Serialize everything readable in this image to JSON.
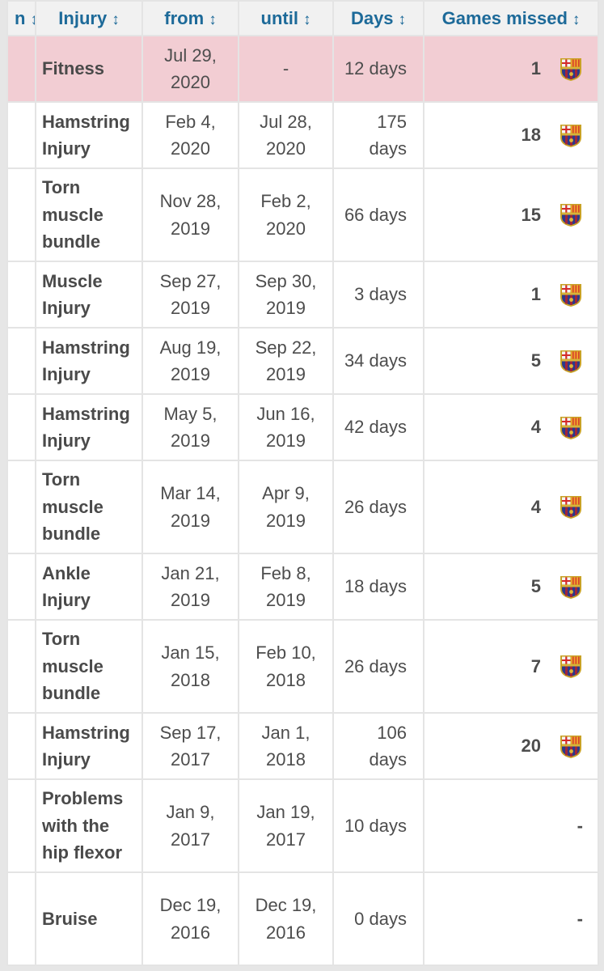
{
  "table": {
    "headers": [
      {
        "label": "n",
        "sort_icon": "↕"
      },
      {
        "label": "Injury",
        "sort_icon": "↕"
      },
      {
        "label": "from",
        "sort_icon": "↕"
      },
      {
        "label": "until",
        "sort_icon": "↕"
      },
      {
        "label": "Days",
        "sort_icon": "↕"
      },
      {
        "label": "Games missed",
        "sort_icon": "↕"
      }
    ],
    "rows": [
      {
        "injury": "Fitness",
        "from": "Jul 29, 2020",
        "until": "-",
        "days": "12 days",
        "games_missed": "1",
        "club_icon": "fc-barcelona-crest-icon",
        "highlighted": true
      },
      {
        "injury": "Hamstring Injury",
        "from": "Feb 4, 2020",
        "until": "Jul 28, 2020",
        "days": "175 days",
        "games_missed": "18",
        "club_icon": "fc-barcelona-crest-icon"
      },
      {
        "injury": "Torn muscle bundle",
        "from": "Nov 28, 2019",
        "until": "Feb 2, 2020",
        "days": "66 days",
        "games_missed": "15",
        "club_icon": "fc-barcelona-crest-icon"
      },
      {
        "injury": "Muscle Injury",
        "from": "Sep 27, 2019",
        "until": "Sep 30, 2019",
        "days": "3 days",
        "games_missed": "1",
        "club_icon": "fc-barcelona-crest-icon"
      },
      {
        "injury": "Hamstring Injury",
        "from": "Aug 19, 2019",
        "until": "Sep 22, 2019",
        "days": "34 days",
        "games_missed": "5",
        "club_icon": "fc-barcelona-crest-icon"
      },
      {
        "injury": "Hamstring Injury",
        "from": "May 5, 2019",
        "until": "Jun 16, 2019",
        "days": "42 days",
        "games_missed": "4",
        "club_icon": "fc-barcelona-crest-icon"
      },
      {
        "injury": "Torn muscle bundle",
        "from": "Mar 14, 2019",
        "until": "Apr 9, 2019",
        "days": "26 days",
        "games_missed": "4",
        "club_icon": "fc-barcelona-crest-icon"
      },
      {
        "injury": "Ankle Injury",
        "from": "Jan 21, 2019",
        "until": "Feb 8, 2019",
        "days": "18 days",
        "games_missed": "5",
        "club_icon": "fc-barcelona-crest-icon"
      },
      {
        "injury": "Torn muscle bundle",
        "from": "Jan 15, 2018",
        "until": "Feb 10, 2018",
        "days": "26 days",
        "games_missed": "7",
        "club_icon": "fc-barcelona-crest-icon"
      },
      {
        "injury": "Hamstring Injury",
        "from": "Sep 17, 2017",
        "until": "Jan 1, 2018",
        "days": "106 days",
        "games_missed": "20",
        "club_icon": "fc-barcelona-crest-icon"
      },
      {
        "injury": "Problems with the hip flexor",
        "from": "Jan 9, 2017",
        "until": "Jan 19, 2017",
        "days": "10 days",
        "games_missed": "-",
        "club_icon": null
      },
      {
        "injury": "Bruise",
        "from": "Dec 19, 2016",
        "until": "Dec 19, 2016",
        "days": "0 days",
        "games_missed": "-",
        "club_icon": null
      }
    ]
  },
  "colors": {
    "header_text": "#1d6a99",
    "header_bg": "#f1f1f1",
    "highlight_row_bg": "#f2cdd3",
    "body_text": "#4d4d4d",
    "border": "#e4e4e4"
  }
}
